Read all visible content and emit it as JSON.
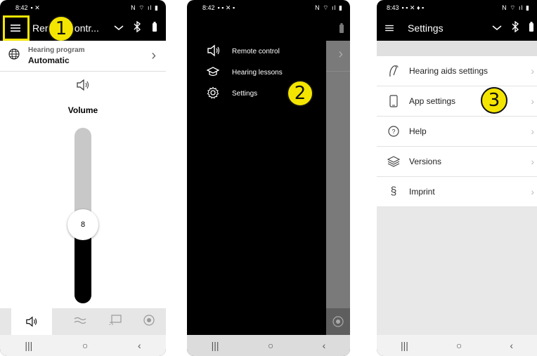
{
  "phone1": {
    "status": {
      "time": "8:42",
      "right_icons": "N ⌔ ıl ▮"
    },
    "appbar": {
      "title": "Remote contr..."
    },
    "hearing_program": {
      "label": "Hearing program",
      "value": "Automatic"
    },
    "volume": {
      "label": "Volume",
      "value": "8",
      "level_fraction": 0.45
    },
    "callout": "1"
  },
  "phone2": {
    "status": {
      "time": "8:42",
      "right_icons": "N ⌔ ıl ▮"
    },
    "menu": [
      {
        "label": "Remote control",
        "icon": "speaker-icon"
      },
      {
        "label": "Hearing lessons",
        "icon": "graduation-cap-icon"
      },
      {
        "label": "Settings",
        "icon": "gear-icon"
      }
    ],
    "callout": "2"
  },
  "phone3": {
    "status": {
      "time": "8:43",
      "right_icons": "N ⌔ ıl ▮"
    },
    "appbar": {
      "title": "Settings"
    },
    "items": [
      {
        "label": "Hearing aids settings",
        "icon": "hearing-aid-icon"
      },
      {
        "label": "App settings",
        "icon": "phone-icon"
      },
      {
        "label": "Help",
        "icon": "help-icon"
      },
      {
        "label": "Versions",
        "icon": "layers-icon"
      },
      {
        "label": "Imprint",
        "icon": "section-icon"
      }
    ],
    "callout": "3"
  },
  "colors": {
    "callout": "#f4e500",
    "dark": "#000000",
    "slider_track": "#c8c8c8"
  }
}
